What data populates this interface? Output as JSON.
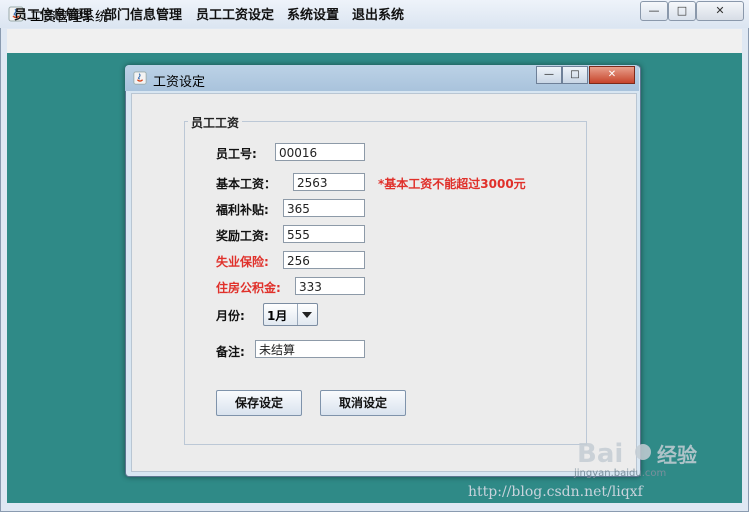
{
  "main_window": {
    "title": "工资管理系统",
    "controls": {
      "minimize": "—",
      "maximize": "□",
      "close": "✕"
    }
  },
  "menubar": {
    "items": [
      {
        "label": "员工信息管理"
      },
      {
        "label": "部门信息管理"
      },
      {
        "label": "员工工资设定"
      },
      {
        "label": "系统设置"
      },
      {
        "label": "退出系统"
      }
    ]
  },
  "dialog": {
    "title": "工资设定",
    "controls": {
      "minimize": "—",
      "maximize": "□",
      "close": "✕"
    },
    "group_title": "员工工资",
    "fields": {
      "employee_no": {
        "label": "员工号:",
        "value": "00016"
      },
      "base_salary": {
        "label": "基本工资：",
        "value": "2563",
        "warning": "*基本工资不能超过3000元"
      },
      "welfare": {
        "label": "福利补贴:",
        "value": "365"
      },
      "bonus": {
        "label": "奖励工资:",
        "value": "555"
      },
      "unemployment": {
        "label": "失业保险:",
        "value": "256"
      },
      "housing_fund": {
        "label": "住房公积金:",
        "value": "333"
      },
      "month": {
        "label": "月份:",
        "value": "1月"
      },
      "remark": {
        "label": "备注:",
        "value": "未结算"
      }
    },
    "buttons": {
      "save": "保存设定",
      "cancel": "取消设定"
    }
  },
  "watermark": {
    "logo": "Baidu经验",
    "site": "jingyan.baidu.com",
    "url": "http://blog.csdn.net/liqxf"
  },
  "colors": {
    "desktop": "#2f8a87",
    "warning": "#e0302a"
  }
}
